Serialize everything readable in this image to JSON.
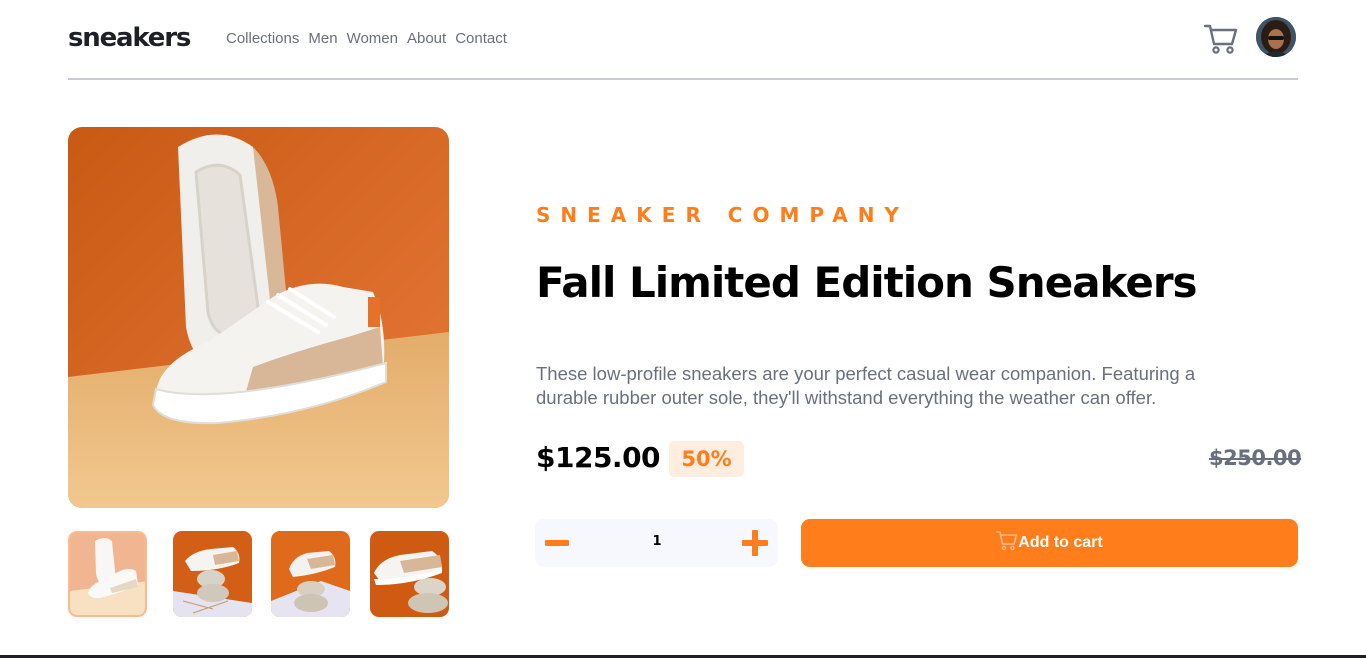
{
  "header": {
    "logo": "sneakers",
    "nav": [
      "Collections",
      "Men",
      "Women",
      "About",
      "Contact"
    ]
  },
  "icons": {
    "cart": "cart-icon",
    "avatar": "avatar",
    "minus": "minus-icon",
    "plus": "plus-icon"
  },
  "product": {
    "company": "SNEAKER COMPANY",
    "title": "Fall Limited Edition Sneakers",
    "description": "These low-profile sneakers are your perfect casual wear companion. Featuring a durable rubber outer sole, they'll withstand everything the weather can offer.",
    "price": "$125.00",
    "discount": "50%",
    "original_price": "$250.00"
  },
  "quantity": {
    "value": "1"
  },
  "cart_button": {
    "label": "Add to cart"
  },
  "colors": {
    "accent": "#ff7e1b",
    "accent_pale": "#ffede0",
    "text_dark": "#1d2026",
    "text_muted": "#69707d"
  }
}
